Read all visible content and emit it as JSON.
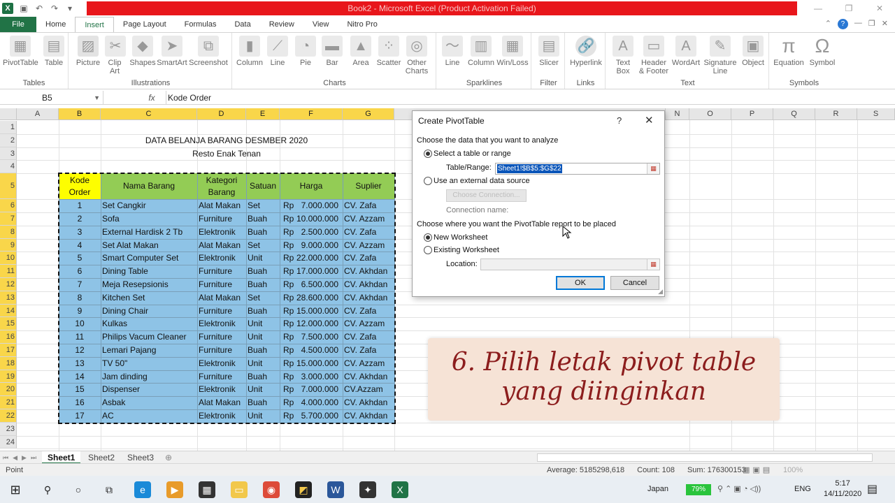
{
  "window": {
    "title": "Book2 - Microsoft Excel (Product Activation Failed)"
  },
  "ribbon_tabs": [
    "File",
    "Home",
    "Insert",
    "Page Layout",
    "Formulas",
    "Data",
    "Review",
    "View",
    "Nitro Pro"
  ],
  "ribbon": {
    "tables": {
      "label": "Tables",
      "buttons": [
        "PivotTable",
        "Table"
      ]
    },
    "illustrations": {
      "label": "Illustrations",
      "buttons": [
        "Picture",
        "Clip Art",
        "Shapes",
        "SmartArt",
        "Screenshot"
      ]
    },
    "charts": {
      "label": "Charts",
      "buttons": [
        "Column",
        "Line",
        "Pie",
        "Bar",
        "Area",
        "Scatter",
        "Other Charts"
      ]
    },
    "sparklines": {
      "label": "Sparklines",
      "buttons": [
        "Line",
        "Column",
        "Win/Loss"
      ]
    },
    "filter": {
      "label": "Filter",
      "buttons": [
        "Slicer"
      ]
    },
    "links": {
      "label": "Links",
      "buttons": [
        "Hyperlink"
      ]
    },
    "text": {
      "label": "Text",
      "buttons": [
        "Text Box",
        "Header & Footer",
        "WordArt",
        "Signature Line",
        "Object"
      ]
    },
    "symbols": {
      "label": "Symbols",
      "buttons": [
        "Equation",
        "Symbol"
      ]
    }
  },
  "formula_bar": {
    "name_box": "B5",
    "fx": "fx",
    "content": "Kode Order"
  },
  "columns": [
    "A",
    "B",
    "C",
    "D",
    "E",
    "F",
    "G",
    "N",
    "O",
    "P",
    "Q",
    "R",
    "S"
  ],
  "rows": [
    "1",
    "2",
    "3",
    "4",
    "5",
    "6",
    "7",
    "8",
    "9",
    "10",
    "11",
    "12",
    "13",
    "14",
    "15",
    "16",
    "17",
    "18",
    "19",
    "20",
    "21",
    "22",
    "23",
    "24"
  ],
  "sheet": {
    "title": "DATA BELANJA BARANG DESMBER 2020",
    "subtitle": "Resto Enak Tenan",
    "headers": [
      "Kode Order",
      "Nama Barang",
      "Kategori Barang",
      "Satuan",
      "Harga",
      "Suplier"
    ],
    "header_lines": [
      [
        "Kode",
        "Order"
      ],
      [
        "Nama Barang"
      ],
      [
        "Kategori",
        "Barang"
      ],
      [
        "Satuan"
      ],
      [
        "Harga"
      ],
      [
        "Suplier"
      ]
    ],
    "rows": [
      [
        "1",
        "Set Cangkir",
        "Alat Makan",
        "Set",
        "Rp",
        "7.000.000",
        "CV. Zafa"
      ],
      [
        "2",
        "Sofa",
        "Furniture",
        "Buah",
        "Rp",
        "10.000.000",
        "CV. Azzam"
      ],
      [
        "3",
        "External Hardisk 2 Tb",
        "Elektronik",
        "Buah",
        "Rp",
        "2.500.000",
        "CV. Zafa"
      ],
      [
        "4",
        "Set Alat Makan",
        "Alat Makan",
        "Set",
        "Rp",
        "9.000.000",
        "CV. Azzam"
      ],
      [
        "5",
        "Smart Computer Set",
        "Elektronik",
        "Unit",
        "Rp",
        "22.000.000",
        "CV. Zafa"
      ],
      [
        "6",
        "Dining Table",
        "Furniture",
        "Buah",
        "Rp",
        "17.000.000",
        "CV. Akhdan"
      ],
      [
        "7",
        "Meja Resepsionis",
        "Furniture",
        "Buah",
        "Rp",
        "6.500.000",
        "CV. Akhdan"
      ],
      [
        "8",
        "Kitchen Set",
        "Alat Makan",
        "Set",
        "Rp",
        "28.600.000",
        "CV. Akhdan"
      ],
      [
        "9",
        "Dining Chair",
        "Furniture",
        "Buah",
        "Rp",
        "15.000.000",
        "CV. Zafa"
      ],
      [
        "10",
        "Kulkas",
        "Elektronik",
        "Unit",
        "Rp",
        "12.000.000",
        "CV. Azzam"
      ],
      [
        "11",
        "Philips Vacum Cleaner",
        "Furniture",
        "Unit",
        "Rp",
        "7.500.000",
        "CV. Zafa"
      ],
      [
        "12",
        "Lemari Pajang",
        "Furniture",
        "Buah",
        "Rp",
        "4.500.000",
        "CV. Zafa"
      ],
      [
        "13",
        "TV 50\"",
        "Elektronik",
        "Unit",
        "Rp",
        "15.000.000",
        "CV. Azzam"
      ],
      [
        "14",
        "Jam dinding",
        "Furniture",
        "Buah",
        "Rp",
        "3.000.000",
        "CV. Akhdan"
      ],
      [
        "15",
        "Dispenser",
        "Elektronik",
        "Unit",
        "Rp",
        "7.000.000",
        "CV.Azzam"
      ],
      [
        "16",
        "Asbak",
        "Alat Makan",
        "Buah",
        "Rp",
        "4.000.000",
        "CV. Akhdan"
      ],
      [
        "17",
        "AC",
        "Elektronik",
        "Unit",
        "Rp",
        "5.700.000",
        "CV. Akhdan"
      ]
    ]
  },
  "dialog": {
    "title": "Create PivotTable",
    "help": "?",
    "close": "✕",
    "section1": "Choose the data that you want to analyze",
    "opt_select": "Select a table or range",
    "table_range_label": "Table/Range:",
    "table_range_value": "Sheet1!$B$5:$G$22",
    "opt_external": "Use an external data source",
    "choose_connection": "Choose Connection...",
    "connection_name": "Connection name:",
    "section2": "Choose where you want the PivotTable report to be placed",
    "opt_new": "New Worksheet",
    "opt_existing": "Existing Worksheet",
    "location_label": "Location:",
    "ok": "OK",
    "cancel": "Cancel",
    "selected_option_1": "Select a table or range",
    "selected_option_2": "New Worksheet"
  },
  "caption": {
    "line1": "6. Pilih letak pivot table",
    "line2": "yang diinginkan"
  },
  "sheet_tabs": [
    "Sheet1",
    "Sheet2",
    "Sheet3"
  ],
  "active_sheet": "Sheet1",
  "status": {
    "mode": "Point",
    "average": "Average: 5185298,618",
    "count": "Count: 108",
    "sum": "Sum: 176300153",
    "zoom": "100%"
  },
  "taskbar": {
    "language": "Japan",
    "battery": "79%",
    "input": "ENG",
    "time": "5:17",
    "date": "14/11/2020"
  },
  "colors": {
    "excel_green": "#217346",
    "title_red": "#e8161b",
    "table_blue": "#8ec3e6",
    "header_yellow": "#fefe00",
    "header_green": "#93cc55",
    "caption_bg": "#f6e3d6",
    "caption_text": "#8c1d1d"
  }
}
